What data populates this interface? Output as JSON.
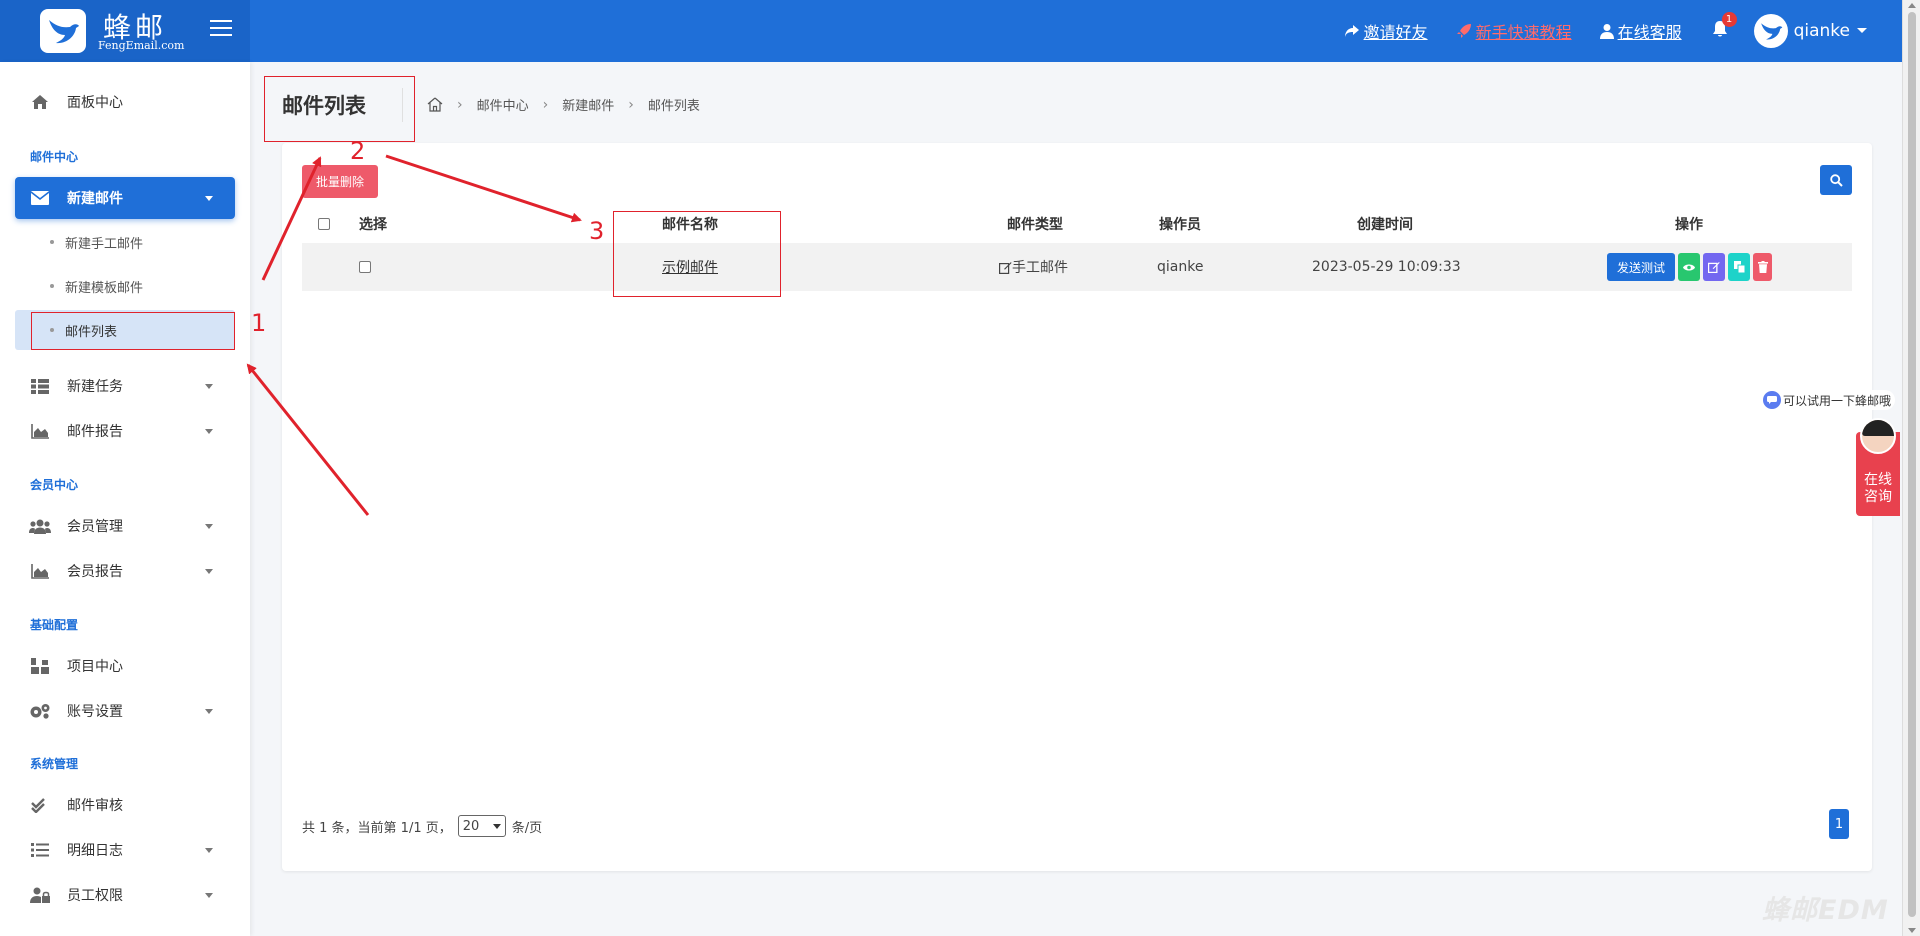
{
  "brand": {
    "name": "蜂邮",
    "subtitle": "FengEmail.com"
  },
  "topbar": {
    "invite": "邀请好友",
    "tutorial": "新手快速教程",
    "support": "在线客服",
    "notification_count": "1",
    "username": "qianke"
  },
  "sidebar": {
    "dashboard": "面板中心",
    "section_mail": "邮件中心",
    "new_mail": "新建邮件",
    "sub_manual": "新建手工邮件",
    "sub_template": "新建模板邮件",
    "sub_list": "邮件列表",
    "new_task": "新建任务",
    "mail_report": "邮件报告",
    "section_member": "会员中心",
    "member_manage": "会员管理",
    "member_report": "会员报告",
    "section_base": "基础配置",
    "project_center": "项目中心",
    "account_settings": "账号设置",
    "section_system": "系统管理",
    "mail_audit": "邮件审核",
    "detail_log": "明细日志",
    "staff_perm": "员工权限"
  },
  "page": {
    "title": "邮件列表",
    "breadcrumb": [
      "邮件中心",
      "新建邮件",
      "邮件列表"
    ]
  },
  "toolbar": {
    "bulk_delete": "批量删除"
  },
  "table": {
    "headers": {
      "select": "选择",
      "name": "邮件名称",
      "type": "邮件类型",
      "operator": "操作员",
      "created": "创建时间",
      "actions": "操作"
    },
    "rows": [
      {
        "name": "示例邮件",
        "type": "手工邮件",
        "operator": "qianke",
        "created": "2023-05-29 10:09:33",
        "send_test": "发送测试"
      }
    ]
  },
  "pager": {
    "prefix": "共 1 条，当前第 1/1 页，",
    "page_size": "20",
    "suffix": "条/页",
    "current": "1"
  },
  "annotations": {
    "n1": "1",
    "n2": "2",
    "n3": "3"
  },
  "widgets": {
    "try_text": "可以试用一下蜂邮哦",
    "consult_line1": "在线",
    "consult_line2": "咨询",
    "watermark": "蜂邮EDM"
  },
  "colors": {
    "primary": "#1f6fd8",
    "danger": "#ee5a6a",
    "annotation": "#e0222c"
  }
}
